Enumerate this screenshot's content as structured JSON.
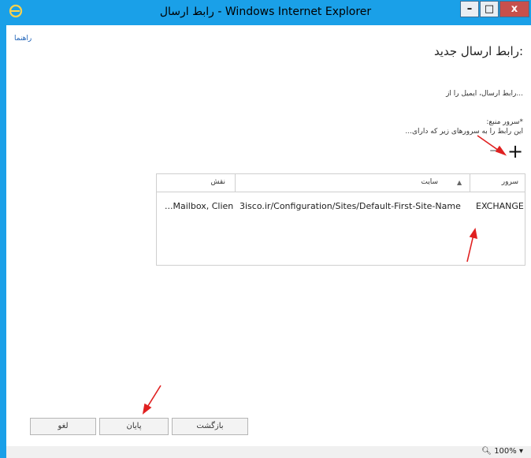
{
  "window": {
    "title": "رابط ارسال - Windows Internet Explorer",
    "controls": {
      "minimize": "–",
      "maximize": "□",
      "close": "x"
    }
  },
  "help": {
    "label": "راهنما"
  },
  "page": {
    "title": ":رابط ارسال جدید",
    "intro": "...رابط ارسال، ایمیل را از",
    "source_label": "*سرور منبع:",
    "source_desc": "این رابط را به سرورهای زیر که دارای..."
  },
  "toolbar": {
    "add": "+",
    "remove": "−"
  },
  "grid": {
    "columns": [
      "سرور",
      "سایت",
      "نقش"
    ],
    "rows": [
      {
        "server": "EXCHANGE",
        "site": "3isco.ir/Configuration/Sites/Default-First-Site-Name",
        "role": "...Mailbox, Clien"
      }
    ]
  },
  "buttons": {
    "back": "بازگشت",
    "finish": "پایان",
    "cancel": "لغو"
  },
  "status": {
    "zoom": "100%"
  },
  "colors": {
    "frame": "#1aa0e8",
    "close": "#c7504c",
    "arrow": "#e02020",
    "link": "#1f63b8"
  }
}
